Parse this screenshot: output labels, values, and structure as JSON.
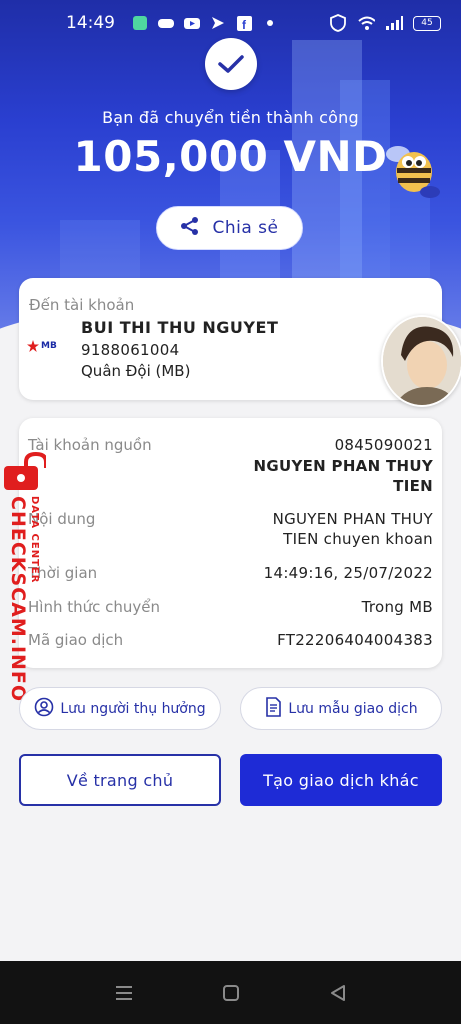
{
  "status_bar": {
    "time": "14:49",
    "battery": "45",
    "icons": [
      "app-icon",
      "game-controller-icon",
      "youtube-icon",
      "send-icon",
      "facebook-icon",
      "dot-icon",
      "shield-icon",
      "wifi-icon",
      "signal-icon"
    ]
  },
  "hero": {
    "success_text": "Bạn đã chuyển tiền thành công",
    "amount": "105,000 VND",
    "share_label": "Chia sẻ"
  },
  "recipient": {
    "label": "Đến tài khoản",
    "bank_logo": "MB",
    "name": "BUI THI THU NGUYET",
    "account": "9188061004",
    "bank": "Quân Đội (MB)"
  },
  "details": {
    "source_label": "Tài khoản nguồn",
    "source_account": "0845090021",
    "source_name_line1": "NGUYEN PHAN THUY",
    "source_name_line2": "TIEN",
    "content_label": "Nội dung",
    "content_line1": "NGUYEN PHAN THUY",
    "content_line2": "TIEN chuyen khoan",
    "time_label": "Thời gian",
    "time_value": "14:49:16, 25/07/2022",
    "method_label": "Hình thức chuyển",
    "method_value": "Trong MB",
    "txn_label": "Mã giao dịch",
    "txn_value": "FT22206404004383"
  },
  "watermark": {
    "text": "CHECKSCAM.INFO",
    "sub": "DATA CENTER"
  },
  "actions": {
    "save_recipient": "Lưu người thụ hưởng",
    "save_template": "Lưu mẫu giao dịch",
    "home": "Về trang chủ",
    "new_transaction": "Tạo giao dịch khác"
  },
  "colors": {
    "brand_blue": "#2731a7",
    "primary_button": "#1e2bd6",
    "watermark_red": "#e01e1e"
  }
}
